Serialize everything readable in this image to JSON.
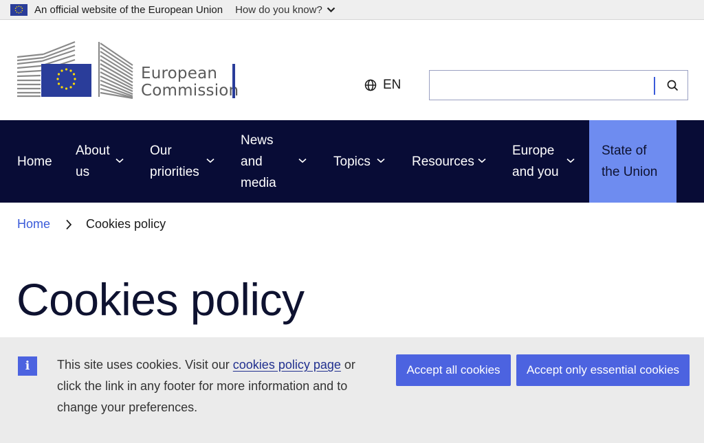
{
  "eu_banner": {
    "official_text": "An official website of the European Union",
    "how_text": "How do you know?"
  },
  "header": {
    "logo_line1": "European",
    "logo_line2": "Commission",
    "language": "EN",
    "search": {
      "value": "",
      "placeholder": ""
    }
  },
  "nav": {
    "items": [
      {
        "line1": "Home",
        "line2": "",
        "line3": ""
      },
      {
        "line1": "About",
        "line2": "us",
        "line3": ""
      },
      {
        "line1": "Our",
        "line2": "priorities",
        "line3": ""
      },
      {
        "line1": "News",
        "line2": "and",
        "line3": "media"
      },
      {
        "line1": "Topics",
        "line2": "",
        "line3": ""
      },
      {
        "line1": "Resources",
        "line2": "",
        "line3": ""
      },
      {
        "line1": "Europe",
        "line2": "and you",
        "line3": ""
      },
      {
        "line1": "State of",
        "line2": "the Union",
        "line3": ""
      }
    ]
  },
  "breadcrumb": {
    "home": "Home",
    "current": "Cookies policy"
  },
  "page": {
    "title": "Cookies policy"
  },
  "cookie_banner": {
    "text_before": "This site uses cookies. Visit our ",
    "link": "cookies policy page",
    "text_after": " or click the link in any footer for more information and to change your preferences.",
    "accept_all": "Accept all cookies",
    "accept_essential": "Accept only essential cookies"
  },
  "colors": {
    "nav_bg": "#080c36",
    "soteu_bg": "#6e8cf0",
    "primary_button": "#4c63e0",
    "link": "#3a5bd9",
    "eu_blue": "#2a3d9a",
    "eu_yellow": "#ffdd00"
  },
  "icons": [
    "eu-flag-icon",
    "chevron-down-icon",
    "globe-icon",
    "search-icon",
    "chevron-right-icon",
    "info-icon"
  ]
}
